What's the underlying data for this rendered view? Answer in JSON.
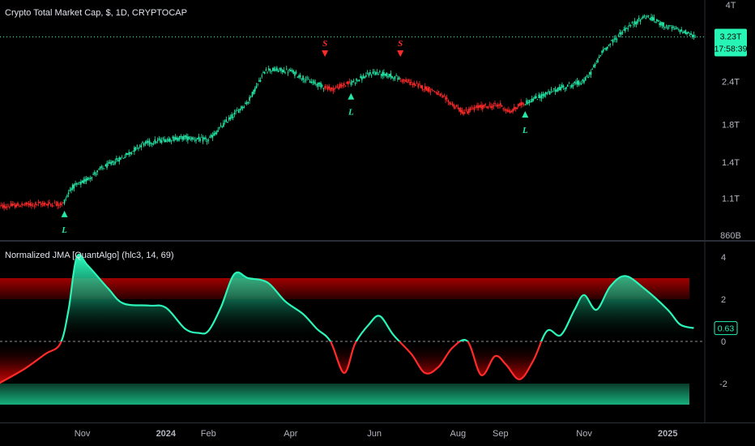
{
  "upper_pane": {
    "title": "Crypto Total Market Cap, $, 1D, CRYPTOCAP",
    "price_badge": {
      "value": "3.23T",
      "countdown": "17:58:39",
      "color": "#26f5b5"
    },
    "y_ticks": [
      "4T",
      "3.23T",
      "2.4T",
      "1.8T",
      "1.4T",
      "1.1T",
      "860B"
    ],
    "signals": [
      {
        "kind": "L",
        "date": "2023-10-19",
        "price": 1.08
      },
      {
        "kind": "S",
        "date": "2024-04-26",
        "price": 2.62
      },
      {
        "kind": "L",
        "date": "2024-05-15",
        "price": 2.37
      },
      {
        "kind": "S",
        "date": "2024-06-20",
        "price": 2.62
      },
      {
        "kind": "L",
        "date": "2024-09-19",
        "price": 2.1
      }
    ]
  },
  "lower_pane": {
    "title": "Normalized JMA [QuantAlgo] (hlc3, 14, 69)",
    "value_badge": {
      "value": "0.63",
      "color": "#26f5b5"
    },
    "y_ticks": [
      "4",
      "2",
      "0",
      "-2"
    ]
  },
  "x_axis_labels": [
    "Nov",
    "2024",
    "Feb",
    "Apr",
    "Jun",
    "Aug",
    "Sep",
    "Nov",
    "2025"
  ],
  "colors": {
    "bull": "#22e8a8",
    "bear": "#ff2a2a",
    "overbought_band": "#8a0000",
    "oversold_band": "#0f9a6a",
    "grid": "#1e222d"
  },
  "chart_data": [
    {
      "type": "line",
      "title": "Crypto Total Market Cap, $, 1D, CRYPTOCAP",
      "y_scale": "log",
      "ylim": [
        0.86,
        4.0
      ],
      "xlim": [
        "2023-09-02",
        "2025-01-28"
      ],
      "last_value": 3.23,
      "x": [
        "2023-09-01",
        "2023-09-15",
        "2023-10-01",
        "2023-10-18",
        "2023-10-24",
        "2023-11-01",
        "2023-11-15",
        "2023-12-01",
        "2023-12-15",
        "2024-01-01",
        "2024-01-15",
        "2024-02-01",
        "2024-02-15",
        "2024-03-01",
        "2024-03-14",
        "2024-04-01",
        "2024-04-15",
        "2024-05-01",
        "2024-05-15",
        "2024-06-01",
        "2024-06-15",
        "2024-07-01",
        "2024-07-15",
        "2024-08-05",
        "2024-08-15",
        "2024-09-01",
        "2024-09-08",
        "2024-09-15",
        "2024-10-01",
        "2024-10-15",
        "2024-11-01",
        "2024-11-06",
        "2024-11-15",
        "2024-12-01",
        "2024-12-16",
        "2025-01-01",
        "2025-01-13",
        "2025-01-21"
      ],
      "y": [
        1.04,
        1.05,
        1.06,
        1.06,
        1.18,
        1.22,
        1.34,
        1.45,
        1.58,
        1.63,
        1.65,
        1.62,
        1.85,
        2.1,
        2.6,
        2.57,
        2.4,
        2.28,
        2.38,
        2.55,
        2.48,
        2.35,
        2.25,
        1.95,
        2.02,
        2.05,
        1.95,
        2.05,
        2.18,
        2.3,
        2.4,
        2.55,
        2.95,
        3.4,
        3.72,
        3.45,
        3.35,
        3.23
      ]
    },
    {
      "type": "area",
      "title": "Normalized JMA [QuantAlgo] (hlc3, 14, 69)",
      "ylim": [
        -3.0,
        4.0
      ],
      "xlim": [
        "2023-09-02",
        "2025-01-28"
      ],
      "bands": [
        {
          "name": "overbought",
          "from": 2.0,
          "to": 3.0
        },
        {
          "name": "oversold",
          "from": -3.0,
          "to": -2.0
        }
      ],
      "zero_line": 0,
      "last_value": 0.63,
      "x": [
        "2023-09-01",
        "2023-09-20",
        "2023-10-05",
        "2023-10-16",
        "2023-10-22",
        "2023-10-28",
        "2023-11-05",
        "2023-11-20",
        "2023-12-01",
        "2023-12-20",
        "2024-01-01",
        "2024-01-15",
        "2024-01-25",
        "2024-02-01",
        "2024-02-10",
        "2024-02-20",
        "2024-03-01",
        "2024-03-15",
        "2024-03-28",
        "2024-04-10",
        "2024-04-20",
        "2024-04-30",
        "2024-05-10",
        "2024-05-18",
        "2024-05-28",
        "2024-06-05",
        "2024-06-15",
        "2024-06-28",
        "2024-07-08",
        "2024-07-18",
        "2024-07-28",
        "2024-08-08",
        "2024-08-18",
        "2024-08-28",
        "2024-09-05",
        "2024-09-15",
        "2024-09-25",
        "2024-10-05",
        "2024-10-15",
        "2024-10-25",
        "2024-11-01",
        "2024-11-10",
        "2024-11-20",
        "2024-12-01",
        "2024-12-15",
        "2025-01-01",
        "2025-01-10",
        "2025-01-20"
      ],
      "y": [
        -2.0,
        -1.3,
        -0.6,
        -0.1,
        1.5,
        4.0,
        3.6,
        2.5,
        1.8,
        1.7,
        1.6,
        0.6,
        0.4,
        0.5,
        1.6,
        3.2,
        3.0,
        2.8,
        1.9,
        1.3,
        0.6,
        0.0,
        -1.5,
        -0.1,
        0.8,
        1.2,
        0.3,
        -0.6,
        -1.5,
        -1.2,
        -0.3,
        0.0,
        -1.6,
        -0.7,
        -1.1,
        -1.8,
        -0.9,
        0.5,
        0.3,
        1.5,
        2.2,
        1.5,
        2.6,
        3.1,
        2.5,
        1.5,
        0.8,
        0.63
      ]
    }
  ]
}
